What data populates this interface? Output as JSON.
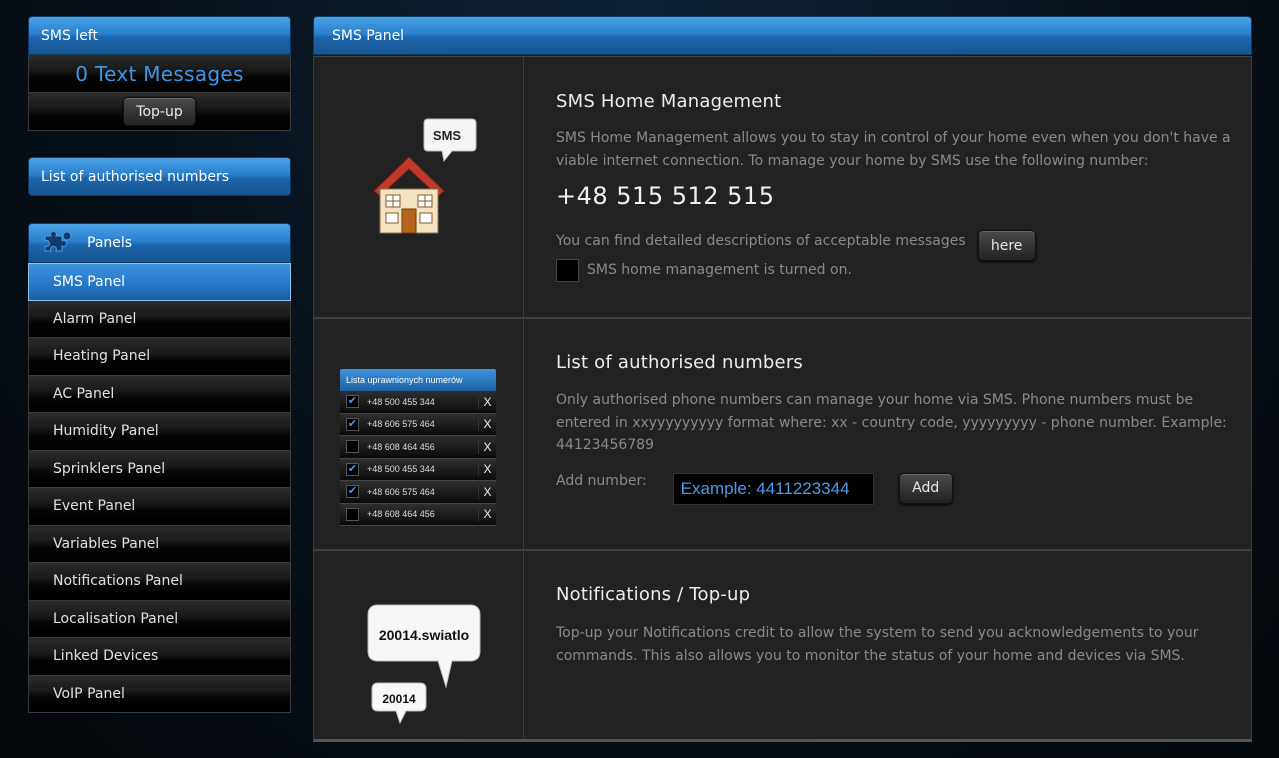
{
  "sidebar": {
    "sms_left": {
      "title": "SMS left",
      "count_text": "0 Text Messages",
      "topup_label": "Top-up"
    },
    "authorised_label": "List of authorised numbers",
    "panels": {
      "title": "Panels",
      "icon": "puzzle-icon",
      "items": [
        {
          "label": "SMS Panel",
          "active": true
        },
        {
          "label": "Alarm Panel"
        },
        {
          "label": "Heating Panel"
        },
        {
          "label": "AC Panel"
        },
        {
          "label": "Humidity Panel"
        },
        {
          "label": "Sprinklers Panel"
        },
        {
          "label": "Event Panel"
        },
        {
          "label": "Variables Panel"
        },
        {
          "label": "Notifications Panel"
        },
        {
          "label": "Localisation Panel"
        },
        {
          "label": "Linked Devices"
        },
        {
          "label": "VoIP Panel"
        }
      ]
    }
  },
  "main": {
    "title": "SMS Panel",
    "home_management": {
      "heading": "SMS Home Management",
      "description": "SMS Home Management allows you to stay in control of your home even when you don't have a viable internet connection. To manage your home by SMS use the following number:",
      "phone": "+48 515 512 515",
      "details_text": "You can find detailed descriptions of acceptable messages",
      "here_label": "here",
      "status_text": "SMS home management is turned on.",
      "image_bubble": "SMS"
    },
    "authorised": {
      "heading": "List of authorised numbers",
      "description": "Only authorised phone numbers can manage your home via SMS. Phone numbers must be entered in xxyyyyyyyyy format where: xx - country code, yyyyyyyyy - phone number. Example: 44123456789",
      "add_label": "Add number:",
      "input_placeholder": "Example: 4411223344",
      "add_button": "Add",
      "image_title": "Lista uprawnionych numerów",
      "image_rows": [
        {
          "number": "+48 500 455 344",
          "checked": true
        },
        {
          "number": "+48 606 575 464",
          "checked": true
        },
        {
          "number": "+48 608 464 456",
          "checked": false
        },
        {
          "number": "+48 500 455 344",
          "checked": true
        },
        {
          "number": "+48 606 575 464",
          "checked": true
        },
        {
          "number": "+48 608 464 456",
          "checked": false
        }
      ],
      "image_row_delete": "X"
    },
    "notifications": {
      "heading": "Notifications / Top-up",
      "description": "Top-up your Notifications credit to allow the system to send you acknowledgements to your commands. This also allows you to monitor the status of your home and devices via SMS.",
      "bubble_large": "20014.swiatlo",
      "bubble_small": "20014"
    }
  },
  "colors": {
    "accent_blue": "#2a7fcc",
    "count_blue": "#3f96e8"
  }
}
